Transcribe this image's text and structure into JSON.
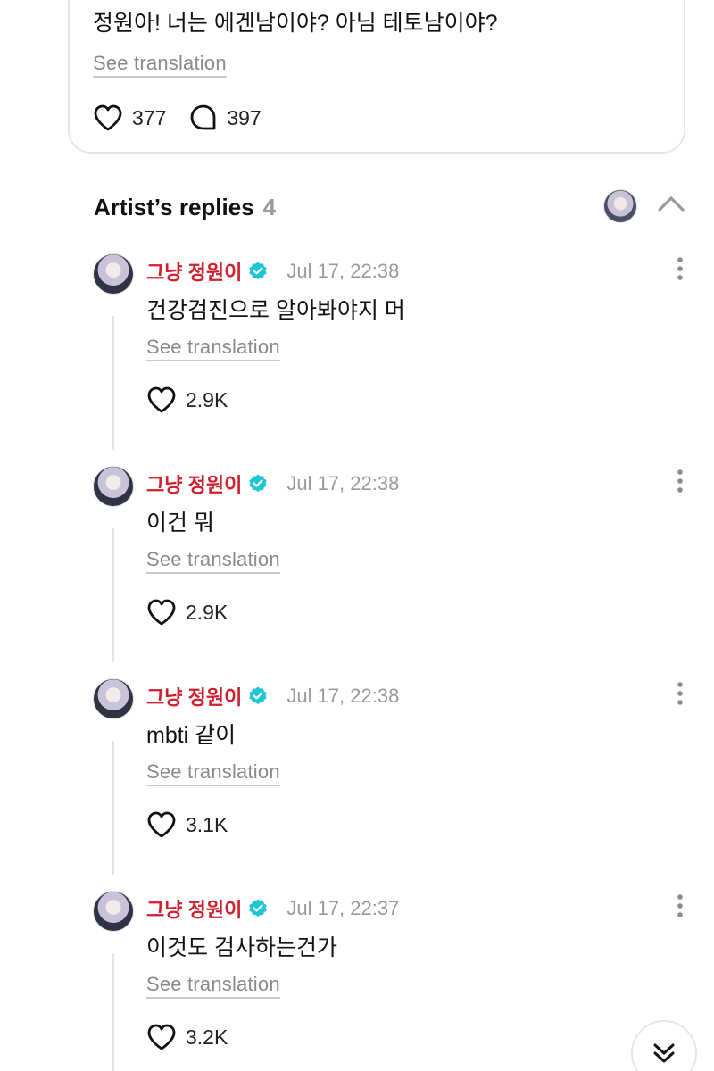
{
  "post": {
    "text": "정원아! 너는 에겐남이야? 아님 테토남이야?",
    "see_translation": "See translation",
    "like_count": "377",
    "comment_count": "397",
    "icons": {
      "like": "heart-icon",
      "comment": "comment-bubble-icon"
    }
  },
  "section": {
    "title": "Artist’s replies",
    "count": "4",
    "icons": {
      "collapse": "chevron-up-icon"
    }
  },
  "replies": [
    {
      "name": "그냥 정원이",
      "time": "Jul 17, 22:38",
      "text": "건강검진으로 알아봐야지 머",
      "see_translation": "See translation",
      "likes": "2.9K"
    },
    {
      "name": "그냥 정원이",
      "time": "Jul 17, 22:38",
      "text": "이건 뭐",
      "see_translation": "See translation",
      "likes": "2.9K"
    },
    {
      "name": "그냥 정원이",
      "time": "Jul 17, 22:38",
      "text": "mbti 같이",
      "see_translation": "See translation",
      "likes": "3.1K"
    },
    {
      "name": "그냥 정원이",
      "time": "Jul 17, 22:37",
      "text": "이것도 검사하는건가",
      "see_translation": "See translation",
      "likes": "3.2K"
    }
  ],
  "icons": {
    "verified": "verified-badge-icon",
    "more": "more-vertical-icon",
    "scroll_down": "double-chevron-down-icon"
  },
  "colors": {
    "artist_name": "#d0202e",
    "verified_badge": "#1fc4d6",
    "muted_text": "#9a9a9e"
  }
}
